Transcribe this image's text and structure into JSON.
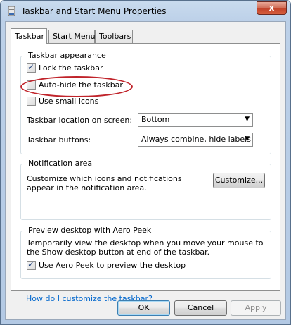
{
  "window": {
    "title": "Taskbar and Start Menu Properties",
    "close_glyph": "x"
  },
  "tabs": [
    "Taskbar",
    "Start Menu",
    "Toolbars"
  ],
  "appearance": {
    "group_label": "Taskbar appearance",
    "lock_label": "Lock the taskbar",
    "lock_checked": true,
    "autohide_label": "Auto-hide the taskbar",
    "autohide_checked": false,
    "small_icons_label": "Use small icons",
    "small_icons_checked": false,
    "location_label": "Taskbar location on screen:",
    "location_value": "Bottom",
    "buttons_label": "Taskbar buttons:",
    "buttons_value": "Always combine, hide labels"
  },
  "notification": {
    "group_label": "Notification area",
    "description": "Customize which icons and notifications appear in the notification area.",
    "customize_button": "Customize..."
  },
  "peek": {
    "group_label": "Preview desktop with Aero Peek",
    "description": "Temporarily view the desktop when you move your mouse to the Show desktop button at end of the taskbar.",
    "checkbox_label": "Use Aero Peek to preview the desktop",
    "checked": true
  },
  "help_link": "How do I customize the taskbar?",
  "buttons": {
    "ok": "OK",
    "cancel": "Cancel",
    "apply": "Apply"
  },
  "annotation": {
    "highlight_color": "#c0232a"
  }
}
